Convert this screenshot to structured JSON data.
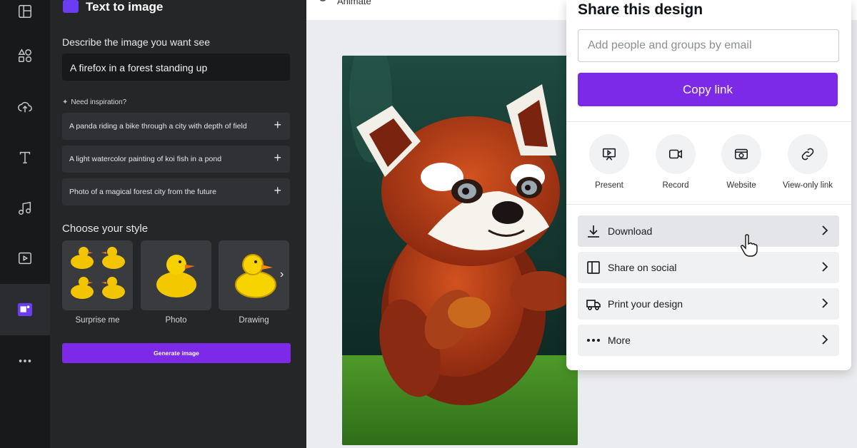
{
  "panel": {
    "title": "Text to image",
    "describe_label": "Describe the image you want see",
    "prompt_value": "A firefox in a forest standing up",
    "inspiration_label": "Need inspiration?",
    "suggestions": [
      {
        "text": "A panda riding a bike through a city with depth of field"
      },
      {
        "text": "A light watercolor painting of koi fish in a pond"
      },
      {
        "text": "Photo of a magical forest city from the future"
      }
    ],
    "style_label": "Choose your style",
    "styles": [
      {
        "label": "Surprise me"
      },
      {
        "label": "Photo"
      },
      {
        "label": "Drawing"
      }
    ],
    "generate_label": "Generate image"
  },
  "topbar": {
    "animate_label": "Animate"
  },
  "share": {
    "title": "Share this design",
    "email_placeholder": "Add people and groups by email",
    "copy_link_label": "Copy link",
    "options": [
      {
        "label": "Present",
        "icon": "present-icon"
      },
      {
        "label": "Record",
        "icon": "record-icon"
      },
      {
        "label": "Website",
        "icon": "website-icon"
      },
      {
        "label": "View-only link",
        "icon": "link-icon"
      }
    ],
    "rows": [
      {
        "label": "Download",
        "icon": "download-icon"
      },
      {
        "label": "Share on social",
        "icon": "social-icon"
      },
      {
        "label": "Print your design",
        "icon": "truck-icon"
      },
      {
        "label": "More",
        "icon": "more-icon"
      }
    ]
  },
  "colors": {
    "accent": "#7d2ae8",
    "panel_bg": "#252627",
    "rail_bg": "#18191b"
  }
}
